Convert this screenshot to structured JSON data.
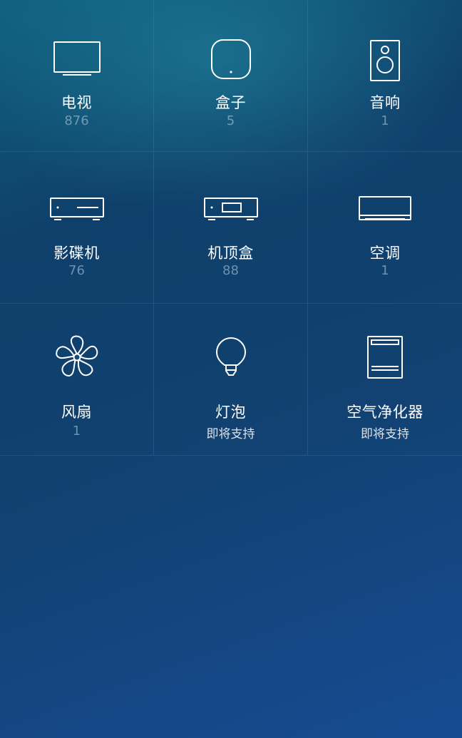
{
  "devices": [
    {
      "label": "电视",
      "count": "876",
      "icon": "tv-icon"
    },
    {
      "label": "盒子",
      "count": "5",
      "icon": "box-icon"
    },
    {
      "label": "音响",
      "count": "1",
      "icon": "speaker-icon"
    },
    {
      "label": "影碟机",
      "count": "76",
      "icon": "dvd-player-icon"
    },
    {
      "label": "机顶盒",
      "count": "88",
      "icon": "set-top-box-icon"
    },
    {
      "label": "空调",
      "count": "1",
      "icon": "air-conditioner-icon"
    },
    {
      "label": "风扇",
      "count": "1",
      "icon": "fan-icon"
    },
    {
      "label": "灯泡",
      "count": "即将支持",
      "icon": "light-bulb-icon"
    },
    {
      "label": "空气净化器",
      "count": "即将支持",
      "icon": "air-purifier-icon"
    }
  ],
  "colors": {
    "background_top": "#0f5f7e",
    "background_bottom": "#164b92",
    "icon_stroke": "#ffffff",
    "count_text": "#a9c3d7"
  }
}
